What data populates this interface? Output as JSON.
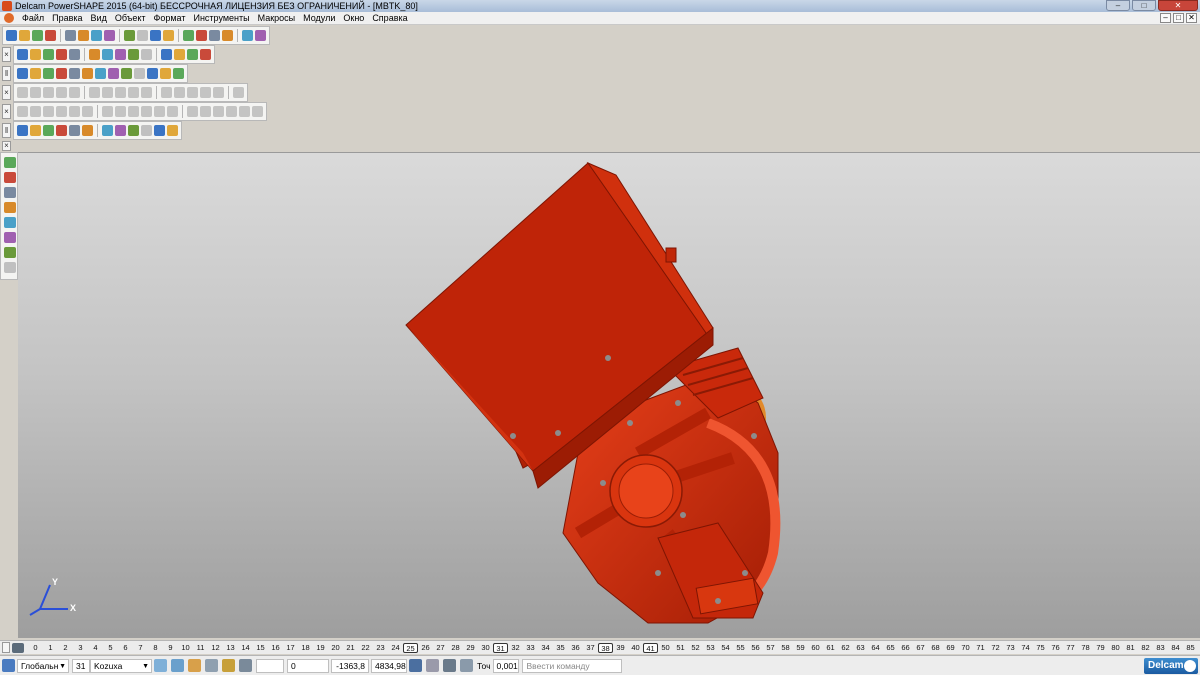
{
  "window": {
    "title": "Delcam PowerSHAPE 2015 (64-bit) БЕССРОЧНАЯ ЛИЦЕНЗИЯ БЕЗ ОГРАНИЧЕНИЙ - [MBTK_80]",
    "buttons": {
      "minimize": "–",
      "maximize": "□",
      "close": "✕"
    }
  },
  "menu": {
    "items": [
      "Файл",
      "Правка",
      "Вид",
      "Объект",
      "Формат",
      "Инструменты",
      "Макросы",
      "Модули",
      "Окно",
      "Справка"
    ],
    "mdi_buttons": [
      "–",
      "□",
      "✕"
    ]
  },
  "toolbars": {
    "row1_icons": [
      "new-icon",
      "open-icon",
      "save-icon",
      "print-icon",
      "cut-icon",
      "copy-icon",
      "paste-icon",
      "delete-icon",
      "undo-icon",
      "redo-icon",
      "line-icon",
      "arc-icon",
      "circle-icon",
      "curve-icon",
      "surface-icon",
      "solid-icon",
      "wireframe-icon",
      "select-icon"
    ],
    "row2_icons": [
      "view-top-icon",
      "view-front-icon",
      "view-right-icon",
      "view-iso-icon",
      "view-persp-icon",
      "zoom-in-icon",
      "zoom-out-icon",
      "zoom-all-icon",
      "zoom-box-icon",
      "globe-icon",
      "shade-icon",
      "shade-edges-icon",
      "light-icon",
      "hand-icon"
    ],
    "row3_icons": [
      "doc-icon",
      "list-icon",
      "grid-icon",
      "sphere-green-icon",
      "sphere-orange-icon",
      "sphere-red-icon",
      "arrow-green-icon",
      "arrow-blue-icon",
      "cube-icon",
      "cube-wire-icon",
      "monitor-icon",
      "target-icon",
      "arrows-icon"
    ],
    "row4_icons": [
      "curve1-icon",
      "curve2-icon",
      "curve3-icon",
      "curve4-icon",
      "curve5-icon",
      "curve6-icon",
      "curve7-icon",
      "curve8-icon",
      "curve9-icon",
      "curve10-icon",
      "curve11-icon",
      "curve12-icon",
      "curve13-icon",
      "curve14-icon",
      "curve15-icon",
      "curve16-icon"
    ],
    "row5_icons": [
      "surf1-icon",
      "surf2-icon",
      "surf3-icon",
      "surf4-icon",
      "surf5-icon",
      "surf6-icon",
      "surf7-icon",
      "surf8-icon",
      "surf9-icon",
      "surf10-icon",
      "surf11-icon",
      "surf12-icon",
      "surf13-icon",
      "surf14-icon",
      "surf15-icon",
      "surf16-icon",
      "surf17-icon",
      "surf18-icon"
    ],
    "row6_icons": [
      "sphere-gray-icon",
      "xy-icon",
      "cube-blue-icon",
      "cube-green-icon",
      "cube-orange-icon",
      "cube-red-icon",
      "mesh-icon",
      "mesh2-icon",
      "mesh3-icon",
      "mesh4-icon",
      "wave-icon",
      "wave2-icon"
    ]
  },
  "left_toolbar": {
    "icons": [
      "select-arrow-icon",
      "filter-icon",
      "workplane-icon",
      "workplane2-icon",
      "axis-icon",
      "measure-icon",
      "dimension-icon",
      "snap-icon"
    ]
  },
  "viewport": {
    "model_color": "#cc2a0c",
    "axes": {
      "x": "X",
      "y": "Y"
    }
  },
  "levels": {
    "numbers": [
      "0",
      "1",
      "2",
      "3",
      "4",
      "5",
      "6",
      "7",
      "8",
      "9",
      "10",
      "11",
      "12",
      "13",
      "14",
      "15",
      "16",
      "17",
      "18",
      "19",
      "20",
      "21",
      "22",
      "23",
      "24",
      "25",
      "26",
      "27",
      "28",
      "29",
      "30",
      "31",
      "32",
      "33",
      "34",
      "35",
      "36",
      "37",
      "38",
      "39",
      "40",
      "41",
      "50",
      "51",
      "52",
      "53",
      "54",
      "55",
      "56",
      "57",
      "58",
      "59",
      "60",
      "61",
      "62",
      "63",
      "64",
      "65",
      "66",
      "67",
      "68",
      "69",
      "70",
      "71",
      "72",
      "73",
      "74",
      "75",
      "76",
      "77",
      "78",
      "79",
      "80",
      "81",
      "82",
      "83",
      "84",
      "85"
    ],
    "active": [
      "25",
      "31",
      "38",
      "41"
    ]
  },
  "status": {
    "workplane": "Глобальн",
    "level_num": "31",
    "level_name": "Kozuxa",
    "coord_z": "0",
    "coord_x": "-1363,8",
    "coord_y": "4834,98",
    "tolerance_label": "Точ",
    "tolerance_value": "0,001",
    "command_placeholder": "Ввести команду",
    "brand": "Delcam"
  }
}
